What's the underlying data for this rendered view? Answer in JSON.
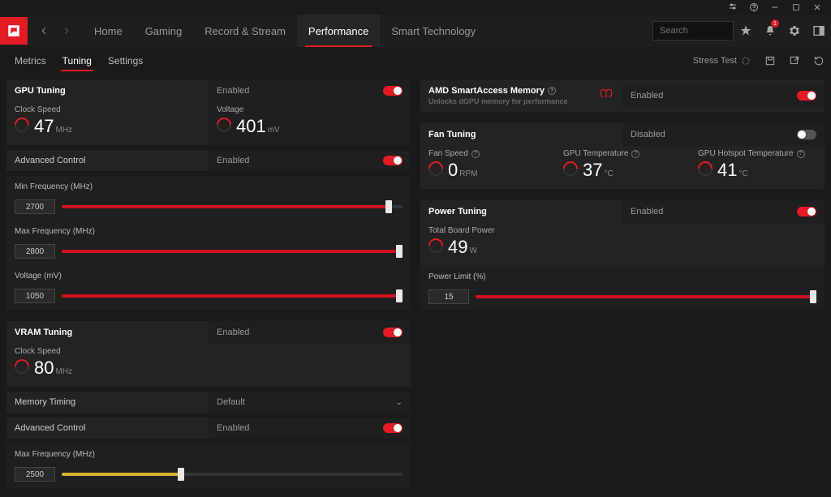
{
  "titlebar": {
    "badge": "1"
  },
  "search": {
    "placeholder": "Search"
  },
  "mainTabs": [
    "Home",
    "Gaming",
    "Record & Stream",
    "Performance",
    "Smart Technology"
  ],
  "mainTabActive": 3,
  "subTabs": [
    "Metrics",
    "Tuning",
    "Settings"
  ],
  "subTabActive": 1,
  "subRight": {
    "stressTest": "Stress Test"
  },
  "gpu": {
    "title": "GPU Tuning",
    "enabled": "Enabled",
    "clockLabel": "Clock Speed",
    "clockVal": "47",
    "clockUnit": "MHz",
    "voltLabel": "Voltage",
    "voltVal": "401",
    "voltUnit": "mV",
    "advCtrl": "Advanced Control",
    "advEnabled": "Enabled",
    "minFreq": {
      "label": "Min Frequency (MHz)",
      "value": "2700",
      "pct": 96
    },
    "maxFreq": {
      "label": "Max Frequency (MHz)",
      "value": "2800",
      "pct": 99
    },
    "voltage": {
      "label": "Voltage (mV)",
      "value": "1050",
      "pct": 99
    }
  },
  "vram": {
    "title": "VRAM Tuning",
    "enabled": "Enabled",
    "clockLabel": "Clock Speed",
    "clockVal": "80",
    "clockUnit": "MHz",
    "memTiming": "Memory Timing",
    "memTimingVal": "Default",
    "advCtrl": "Advanced Control",
    "advEnabled": "Enabled",
    "maxFreq": {
      "label": "Max Frequency (MHz)",
      "value": "2500",
      "pct": 35
    }
  },
  "sam": {
    "title": "AMD SmartAccess Memory",
    "sub": "Unlocks dGPU memory for performance",
    "enabled": "Enabled"
  },
  "fan": {
    "title": "Fan Tuning",
    "state": "Disabled",
    "speed": {
      "label": "Fan Speed",
      "val": "0",
      "unit": "RPM"
    },
    "temp": {
      "label": "GPU Temperature",
      "val": "37",
      "unit": "°C"
    },
    "hot": {
      "label": "GPU Hotspot Temperature",
      "val": "41",
      "unit": "°C"
    }
  },
  "power": {
    "title": "Power Tuning",
    "enabled": "Enabled",
    "tbp": {
      "label": "Total Board Power",
      "val": "49",
      "unit": "W"
    },
    "limit": {
      "label": "Power Limit (%)",
      "value": "15",
      "pct": 99
    }
  }
}
